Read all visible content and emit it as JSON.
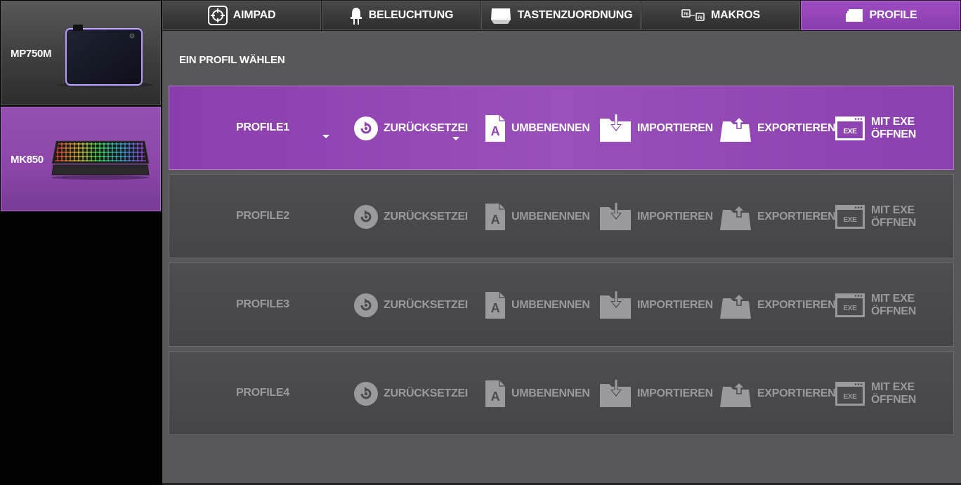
{
  "devices": [
    {
      "label": "MP750M"
    },
    {
      "label": "MK850"
    }
  ],
  "tabs": [
    {
      "label": "AIMPAD",
      "icon": "crosshair-icon"
    },
    {
      "label": "BELEUCHTUNG",
      "icon": "led-icon"
    },
    {
      "label": "TASTENZUORDNUNG",
      "icon": "key-icon"
    },
    {
      "label": "MAKROS",
      "icon": "macro-keys-icon"
    },
    {
      "label": "PROFILE",
      "icon": "profile-cards-icon"
    }
  ],
  "active_tab": "PROFILE",
  "main": {
    "section_title": "EIN PROFIL WÄHLEN",
    "actions": {
      "reset": "ZURÜCKSETZEI",
      "rename": "UMBENENNEN",
      "import": "IMPORTIEREN",
      "export": "EXPORTIEREN",
      "exe": "MIT EXE ÖFFNEN",
      "exe_icon_text": "EXE"
    },
    "profiles": [
      {
        "name": "PROFILE1",
        "active": true
      },
      {
        "name": "PROFILE2",
        "active": false
      },
      {
        "name": "PROFILE3",
        "active": false
      },
      {
        "name": "PROFILE4",
        "active": false
      }
    ]
  },
  "colors": {
    "accent": "#8a3eae",
    "panel": "#58585b",
    "row_inactive": "#4a4a4d",
    "text_inactive": "#9a9a9d"
  }
}
